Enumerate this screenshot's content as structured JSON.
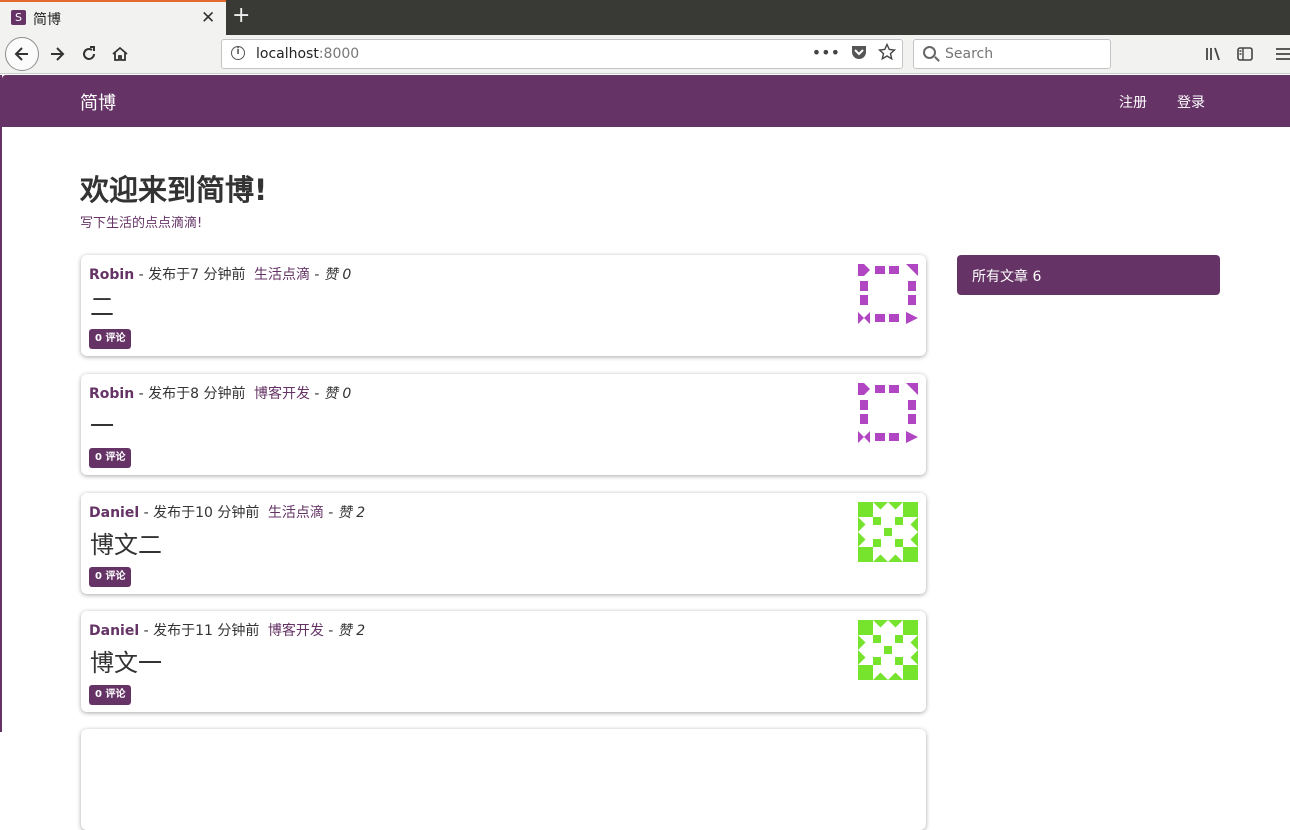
{
  "browser": {
    "tab": {
      "favicon": "S",
      "title": "简博",
      "close": "✕",
      "new_tab": "+"
    },
    "url": {
      "host": "localhost",
      "port": ":8000"
    },
    "search": {
      "placeholder": "Search"
    },
    "icons": [
      "back-icon",
      "forward-icon",
      "reload-icon",
      "home-icon",
      "info-icon",
      "more-icon",
      "pocket-icon",
      "bookmark-star-icon",
      "library-icon",
      "sidebar-icon",
      "menu-icon"
    ]
  },
  "site": {
    "brand": "简博",
    "nav": {
      "register": "注册",
      "login": "登录"
    },
    "accent_color": "#663366"
  },
  "hero": {
    "title": "欢迎来到简博!",
    "subtitle": "写下生活的点点滴滴!"
  },
  "posts": [
    {
      "author": "Robin",
      "time": "- 发布于7 分钟前",
      "category": "生活点滴",
      "likes_prefix": "- ",
      "likes": "赞 0",
      "title": "二",
      "comments": "0 评论",
      "avatar_color": "#b146c2"
    },
    {
      "author": "Robin",
      "time": "- 发布于8 分钟前",
      "category": "博客开发",
      "likes_prefix": "- ",
      "likes": "赞 0",
      "title": "一",
      "comments": "0 评论",
      "avatar_color": "#b146c2"
    },
    {
      "author": "Daniel",
      "time": "- 发布于10 分钟前",
      "category": "生活点滴",
      "likes_prefix": "- ",
      "likes": "赞 2",
      "title": "博文二",
      "comments": "0 评论",
      "avatar_color": "#76e42c"
    },
    {
      "author": "Daniel",
      "time": "- 发布于11 分钟前",
      "category": "博客开发",
      "likes_prefix": "- ",
      "likes": "赞 2",
      "title": "博文一",
      "comments": "0 评论",
      "avatar_color": "#76e42c"
    }
  ],
  "sidebar": {
    "all_posts": "所有文章 6"
  }
}
